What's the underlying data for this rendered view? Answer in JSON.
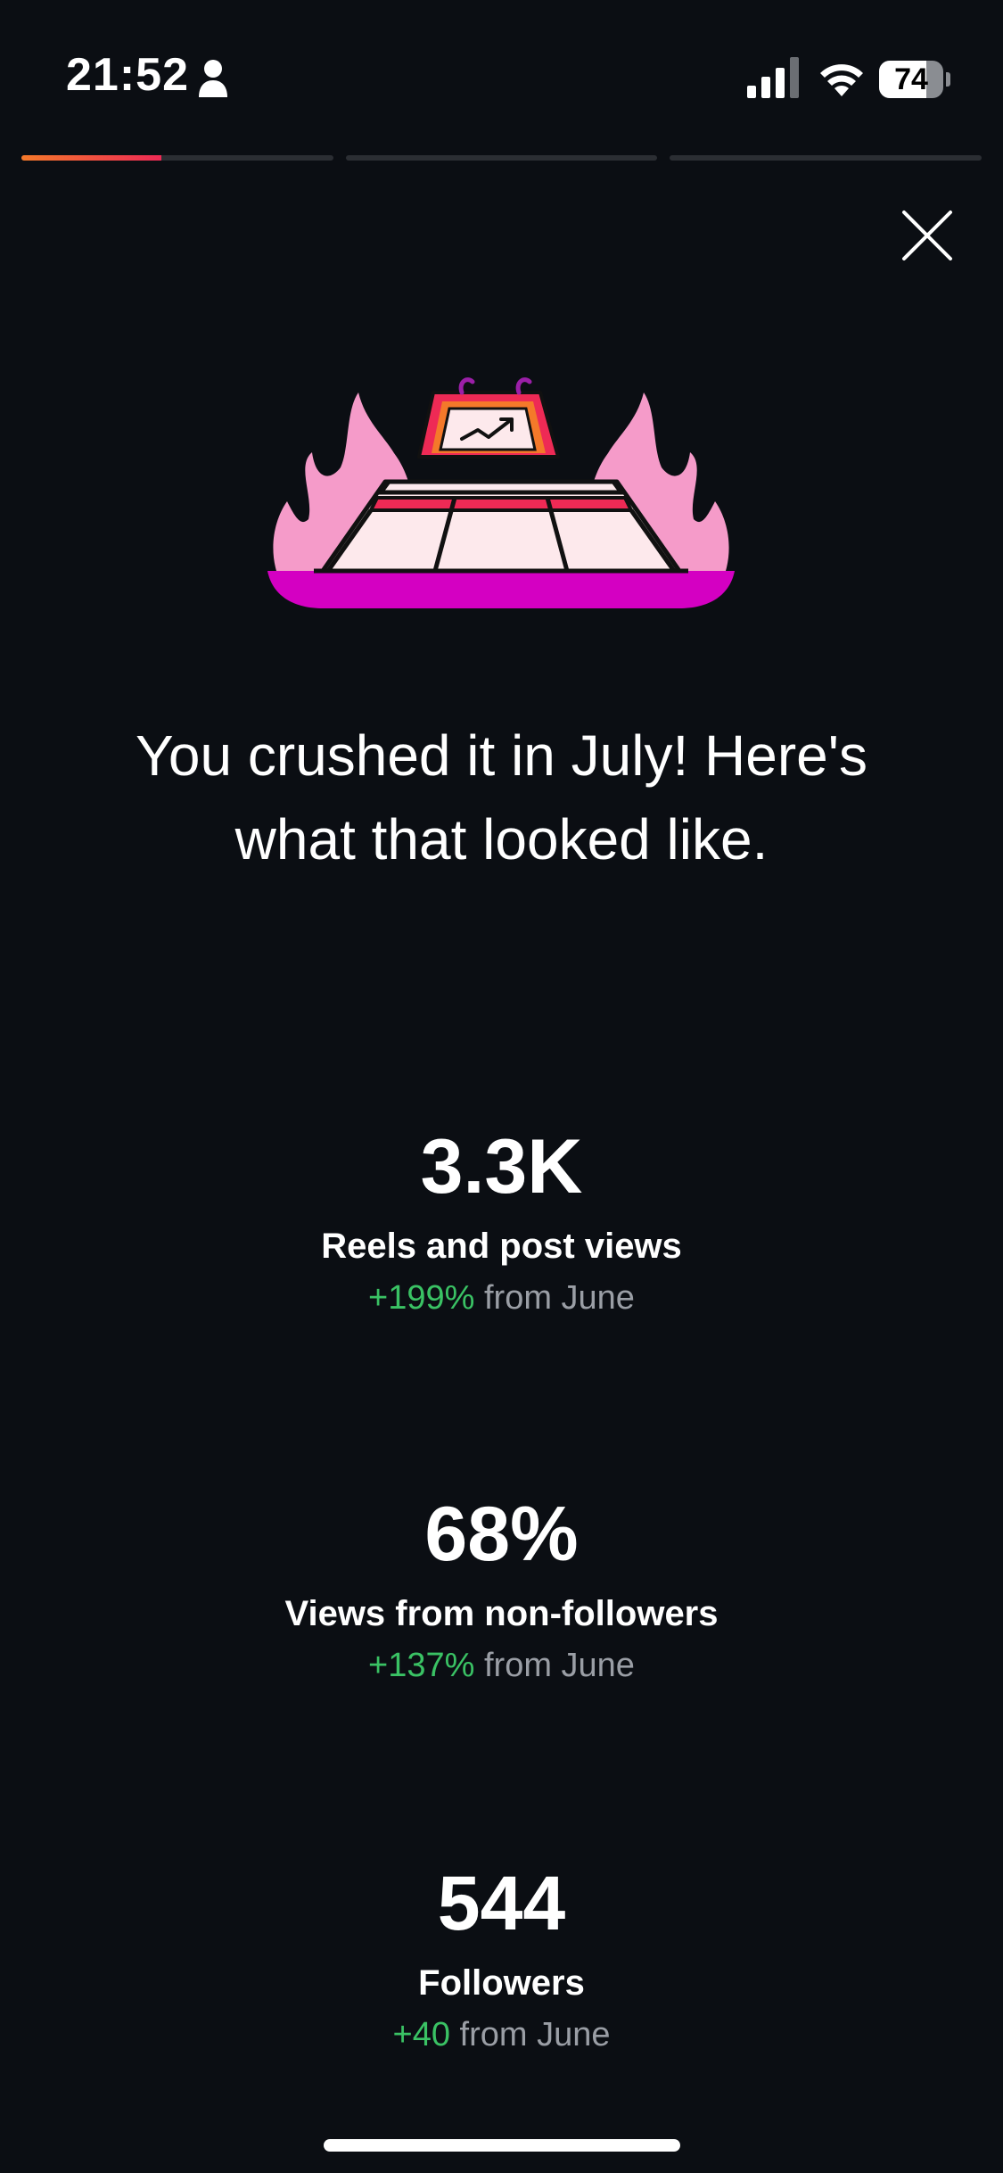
{
  "status_bar": {
    "time": "21:52",
    "battery_level": "74",
    "icons": [
      "person-icon",
      "signal-icon",
      "wifi-icon",
      "battery-icon"
    ]
  },
  "stories": {
    "segments": 3,
    "active_index": 0,
    "active_progress": 0.45,
    "accent_gradient": [
      "#f4792a",
      "#ee2a55"
    ]
  },
  "close_icon": "close-icon",
  "illustration_icon": "chart-on-fire-platter-icon",
  "headline": "You crushed it in July! Here's what that looked like.",
  "stats": [
    {
      "value": "3.3K",
      "label": "Reels and post views",
      "delta": "+199%",
      "delta_suffix": " from June"
    },
    {
      "value": "68%",
      "label": "Views from non-followers",
      "delta": "+137%",
      "delta_suffix": " from June"
    },
    {
      "value": "544",
      "label": "Followers",
      "delta": "+40",
      "delta_suffix": " from June"
    }
  ],
  "colors": {
    "background": "#0b0e13",
    "positive": "#3ac264",
    "muted": "#9a9ea5",
    "flame": "#f59bc9",
    "platter": "#d400c2",
    "accent_red": "#ee2a55"
  }
}
